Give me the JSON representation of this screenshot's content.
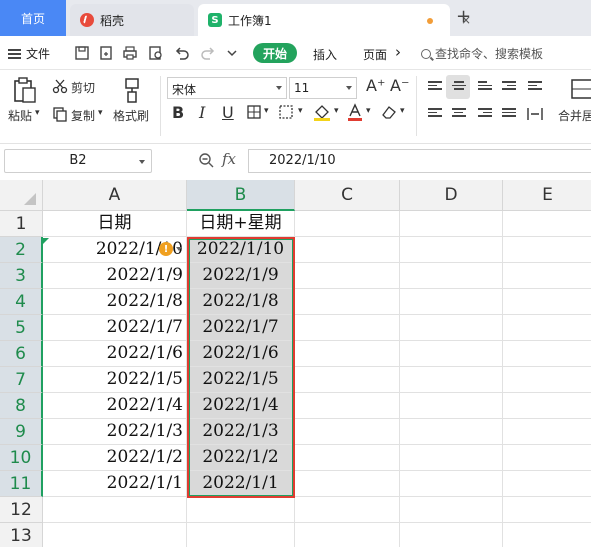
{
  "tabs": {
    "home": "首页",
    "doc": "稻壳",
    "workbook": "工作簿1",
    "close_glyph": "×",
    "add_glyph": "+"
  },
  "menu": {
    "file": "文件",
    "start": "开始",
    "insert": "插入",
    "page": "页面",
    "more_glyph": "›",
    "search": "查找命令、搜索模板"
  },
  "ribbon": {
    "paste": "粘贴",
    "cut": "剪切",
    "copy": "复制",
    "format_painter": "格式刷",
    "font_name": "宋体",
    "font_size": "11",
    "grow_font": "A⁺",
    "shrink_font": "A⁻",
    "bold": "B",
    "italic": "I",
    "underline": "U",
    "merge": "合并居"
  },
  "formula": {
    "cell_ref": "B2",
    "fx": "fx",
    "value": "2022/1/10"
  },
  "sheet": {
    "columns": [
      "A",
      "B",
      "C",
      "D",
      "E"
    ],
    "rows": [
      "1",
      "2",
      "3",
      "4",
      "5",
      "6",
      "7",
      "8",
      "9",
      "10",
      "11",
      "12",
      "13"
    ],
    "header_row": [
      "日期",
      "日期+星期"
    ],
    "col_a": [
      "2022/1/10",
      "2022/1/9",
      "2022/1/8",
      "2022/1/7",
      "2022/1/6",
      "2022/1/5",
      "2022/1/4",
      "2022/1/3",
      "2022/1/2",
      "2022/1/1"
    ],
    "col_b": [
      "2022/1/10",
      "2022/1/9",
      "2022/1/8",
      "2022/1/7",
      "2022/1/6",
      "2022/1/5",
      "2022/1/4",
      "2022/1/3",
      "2022/1/2",
      "2022/1/1"
    ],
    "warning_glyph": "!"
  },
  "colors": {
    "accent_blue": "#4a88f5",
    "start_green": "#23a35d",
    "selection_red": "#e03c31",
    "selection_green": "#1fa060"
  }
}
